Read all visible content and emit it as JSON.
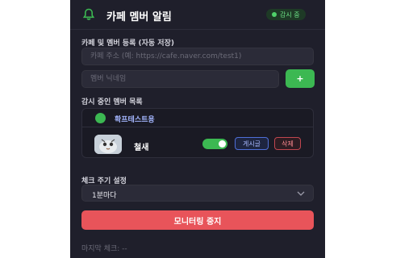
{
  "header": {
    "title": "카페 멤버 알림",
    "status": "감시 중"
  },
  "register": {
    "label": "카페 및 멤버 등록 (자동 저장)",
    "url_placeholder": "카페 주소 (예: https://cafe.naver.com/test1)",
    "nick_placeholder": "멤버 닉네임",
    "add_label": "+"
  },
  "watch": {
    "label": "감시 중인 멤버 목록",
    "cafe_name": "확프테스트용",
    "member": {
      "name": "철새",
      "enabled": true,
      "posts_label": "게시글",
      "delete_label": "삭제"
    }
  },
  "interval": {
    "label": "체크 주기 설정",
    "value": "1분마다"
  },
  "actions": {
    "stop_label": "모니터링 중지"
  },
  "footer": {
    "last_check": "마지막 체크: --"
  },
  "colors": {
    "accent": "#3cb852",
    "danger": "#e8545a",
    "panel": "#1f1f2b"
  },
  "icons": {
    "header": "bell-icon",
    "cafe": "cafe-icon",
    "select": "chevron-down-icon"
  }
}
